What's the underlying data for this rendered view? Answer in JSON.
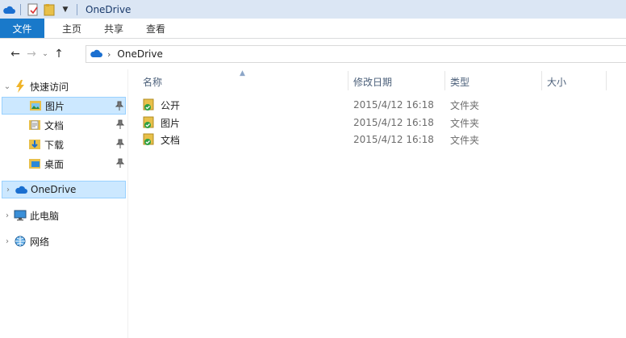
{
  "window": {
    "title": "OneDrive"
  },
  "ribbon": {
    "tabs": [
      "文件",
      "主页",
      "共享",
      "查看"
    ]
  },
  "address": {
    "crumb": "OneDrive"
  },
  "nav": {
    "quick_access": "快速访问",
    "pinned": [
      "图片",
      "文档",
      "下载",
      "桌面"
    ],
    "onedrive": "OneDrive",
    "this_pc": "此电脑",
    "network": "网络"
  },
  "columns": {
    "name": "名称",
    "modified": "修改日期",
    "type": "类型",
    "size": "大小"
  },
  "files": [
    {
      "name": "公开",
      "modified": "2015/4/12 16:18",
      "type": "文件夹"
    },
    {
      "name": "图片",
      "modified": "2015/4/12 16:18",
      "type": "文件夹"
    },
    {
      "name": "文档",
      "modified": "2015/4/12 16:18",
      "type": "文件夹"
    }
  ],
  "colors": {
    "accent": "#1979ca",
    "titlebar": "#dbe6f4",
    "selection": "#cce8ff",
    "folder": "#e8c04a",
    "sync_ok": "#2ea043"
  }
}
